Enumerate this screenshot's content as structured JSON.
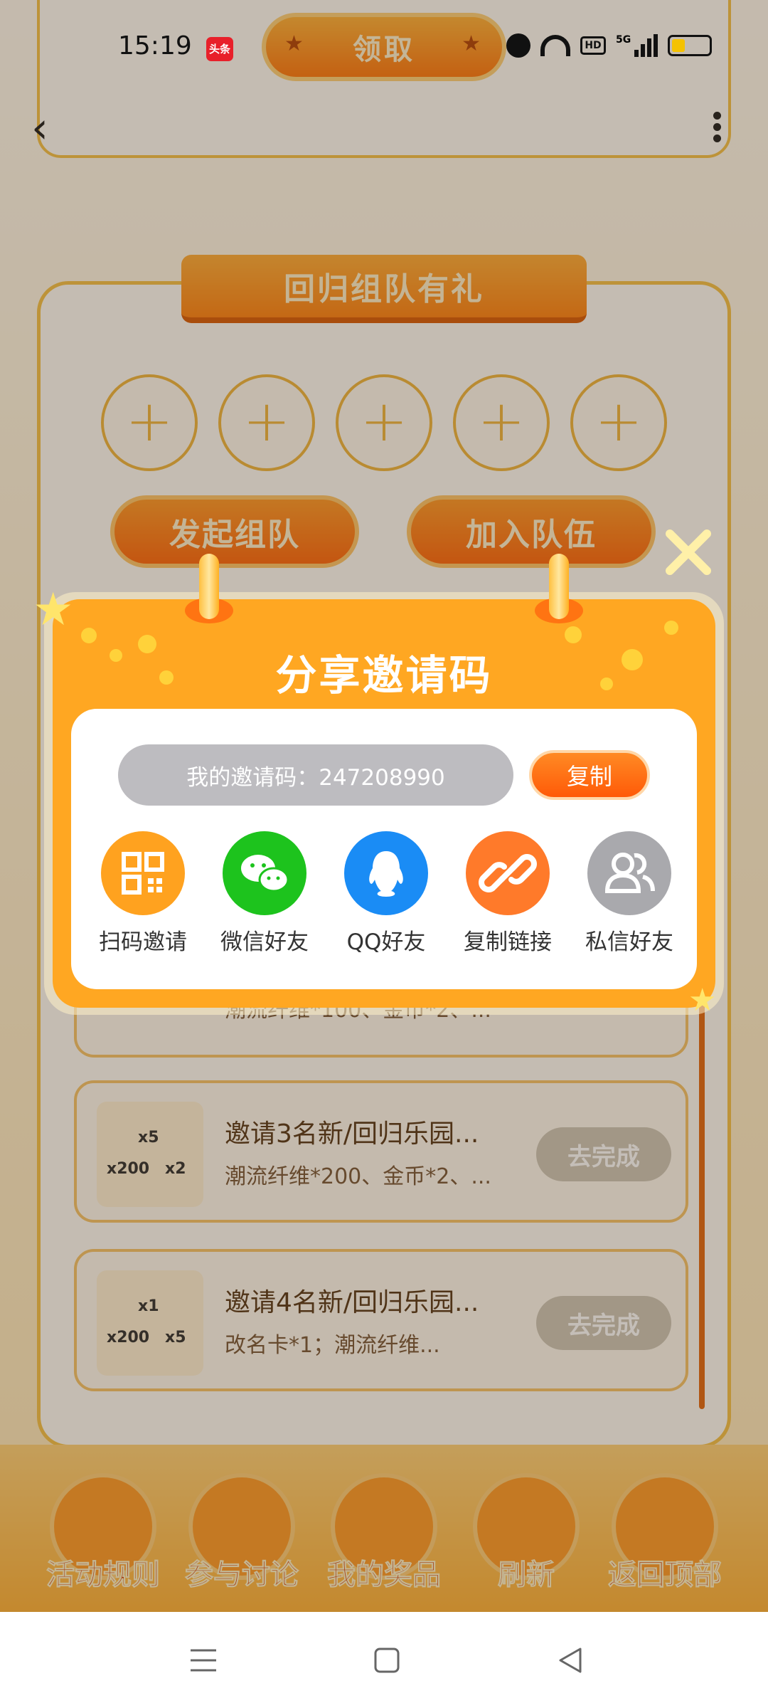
{
  "status_bar": {
    "time": "15:19",
    "news_badge": "头条",
    "network": "5G",
    "hd_label": "HD",
    "battery_color": "#f5c200"
  },
  "header": {
    "claim_button": "领取",
    "back_icon": "chevron-left-icon",
    "more_icon": "more-vertical-icon"
  },
  "team": {
    "title": "回归组队有礼",
    "slot_count": 5,
    "start_team_button": "发起组队",
    "join_team_button": "加入队伍"
  },
  "tasks": {
    "partial_subtitle": "潮流纤维*100、金币*2、...",
    "items": [
      {
        "title": "邀请3名新/回归乐园...",
        "subtitle": "潮流纤维*200、金币*2、...",
        "action": "去完成",
        "badges": [
          "x5",
          "x200",
          "x2"
        ]
      },
      {
        "title": "邀请4名新/回归乐园...",
        "subtitle": "改名卡*1；潮流纤维...",
        "action": "去完成",
        "badges": [
          "x1",
          "x200",
          "x5"
        ]
      }
    ]
  },
  "bottom_nav": [
    {
      "label": "活动规则",
      "icon": "rules-icon"
    },
    {
      "label": "参与讨论",
      "icon": "chat-icon"
    },
    {
      "label": "我的奖品",
      "icon": "gift-icon"
    },
    {
      "label": "刷新",
      "icon": "refresh-icon"
    },
    {
      "label": "返回顶部",
      "icon": "upload-icon"
    }
  ],
  "modal": {
    "title": "分享邀请码",
    "code_text": "我的邀请码：247208990",
    "copy_button": "复制",
    "close_icon": "close-icon",
    "share_options": [
      {
        "label": "扫码邀请",
        "icon": "qr-code-icon",
        "color": "#ffa21f"
      },
      {
        "label": "微信好友",
        "icon": "wechat-icon",
        "color": "#1dc31d"
      },
      {
        "label": "QQ好友",
        "icon": "qq-icon",
        "color": "#1a8cf5"
      },
      {
        "label": "复制链接",
        "icon": "link-icon",
        "color": "#ff7a2a"
      },
      {
        "label": "私信好友",
        "icon": "users-icon",
        "color": "#a9a9ad"
      }
    ]
  },
  "system_nav": {
    "menu_icon": "menu-icon",
    "home_icon": "home-square-icon",
    "back_icon": "back-triangle-icon"
  },
  "colors": {
    "accent_orange": "#ffa722",
    "button_orange": "#ff6a10",
    "overlay": "rgba(60,40,20,0.30)"
  }
}
